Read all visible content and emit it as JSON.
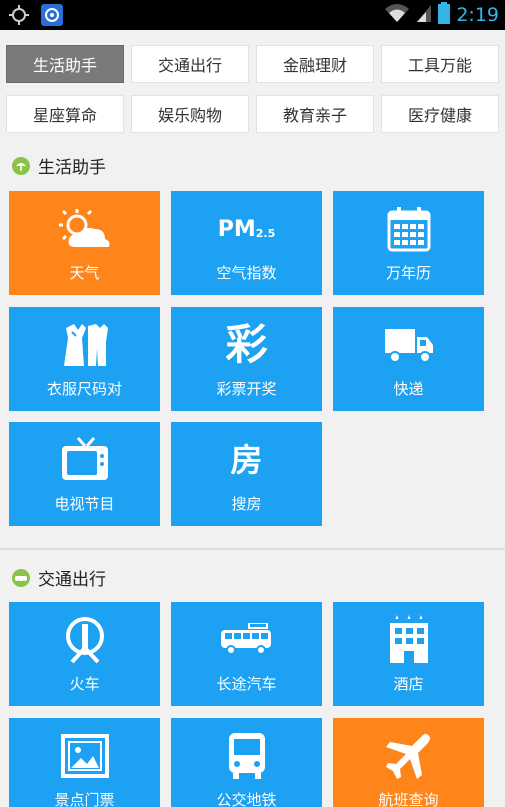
{
  "status_bar": {
    "time": "2:19"
  },
  "categories": [
    {
      "label": "生活助手",
      "active": true
    },
    {
      "label": "交通出行"
    },
    {
      "label": "金融理财"
    },
    {
      "label": "工具万能"
    },
    {
      "label": "星座算命"
    },
    {
      "label": "娱乐购物"
    },
    {
      "label": "教育亲子"
    },
    {
      "label": "医疗健康"
    }
  ],
  "sections": [
    {
      "title": "生活助手",
      "tiles": [
        {
          "label": "天气",
          "icon": "weather-icon",
          "color": "#ff851b"
        },
        {
          "label": "空气指数",
          "icon": "pm25-icon",
          "icon_text": "PM",
          "icon_sub": "2.5"
        },
        {
          "label": "万年历",
          "icon": "calendar-icon"
        },
        {
          "label": "衣服尺码对",
          "icon": "clothes-icon"
        },
        {
          "label": "彩票开奖",
          "icon": "lottery-icon",
          "icon_text": "彩"
        },
        {
          "label": "快递",
          "icon": "truck-icon"
        },
        {
          "label": "电视节目",
          "icon": "tv-icon"
        },
        {
          "label": "搜房",
          "icon": "house-icon",
          "icon_text": "房"
        }
      ]
    },
    {
      "title": "交通出行",
      "tiles": [
        {
          "label": "火车",
          "icon": "train-icon"
        },
        {
          "label": "长途汽车",
          "icon": "bus-icon"
        },
        {
          "label": "酒店",
          "icon": "hotel-icon"
        },
        {
          "label": "景点门票",
          "icon": "picture-icon"
        },
        {
          "label": "公交地铁",
          "icon": "metro-bus-icon"
        },
        {
          "label": "航班查询",
          "icon": "airplane-icon",
          "color": "#ff851b"
        }
      ]
    }
  ]
}
